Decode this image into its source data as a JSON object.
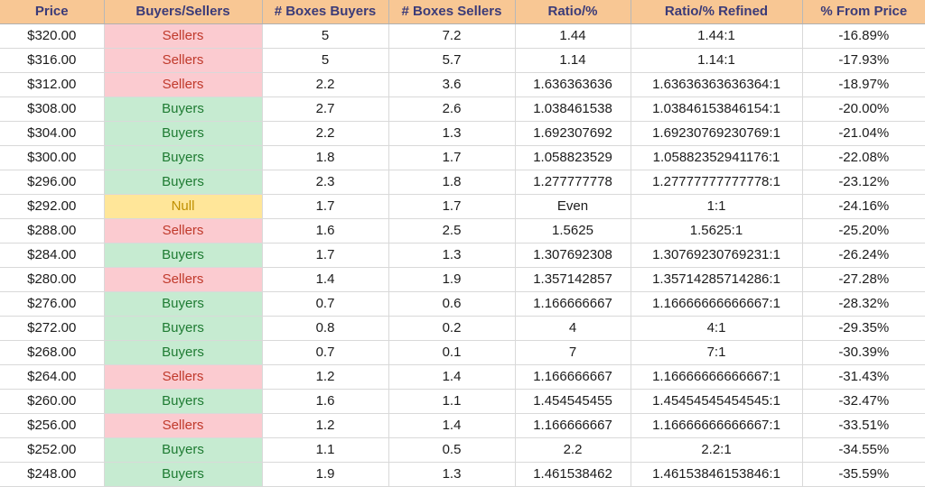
{
  "table": {
    "columns": [
      {
        "key": "price",
        "label": "Price"
      },
      {
        "key": "state",
        "label": "Buyers/Sellers"
      },
      {
        "key": "boxes_buy",
        "label": "# Boxes Buyers"
      },
      {
        "key": "boxes_sell",
        "label": "# Boxes Sellers"
      },
      {
        "key": "ratio",
        "label": "Ratio/%"
      },
      {
        "key": "ratio_ref",
        "label": "Ratio/% Refined"
      },
      {
        "key": "from_price",
        "label": "% From Price"
      }
    ],
    "colors": {
      "header_bg": "#F8C794",
      "header_text": "#3B3B78",
      "buyers_bg": "#C6EBD1",
      "buyers_text": "#1E7B32",
      "sellers_bg": "#FBCBD0",
      "sellers_text": "#C0392B",
      "null_bg": "#FFE699",
      "null_text": "#BF8F00",
      "grid": "#D9D9D9"
    },
    "rows": [
      {
        "price": "$320.00",
        "state": "Sellers",
        "boxes_buy": "5",
        "boxes_sell": "7.2",
        "ratio": "1.44",
        "ratio_ref": "1.44:1",
        "from_price": "-16.89%"
      },
      {
        "price": "$316.00",
        "state": "Sellers",
        "boxes_buy": "5",
        "boxes_sell": "5.7",
        "ratio": "1.14",
        "ratio_ref": "1.14:1",
        "from_price": "-17.93%"
      },
      {
        "price": "$312.00",
        "state": "Sellers",
        "boxes_buy": "2.2",
        "boxes_sell": "3.6",
        "ratio": "1.636363636",
        "ratio_ref": "1.63636363636364:1",
        "from_price": "-18.97%"
      },
      {
        "price": "$308.00",
        "state": "Buyers",
        "boxes_buy": "2.7",
        "boxes_sell": "2.6",
        "ratio": "1.038461538",
        "ratio_ref": "1.03846153846154:1",
        "from_price": "-20.00%"
      },
      {
        "price": "$304.00",
        "state": "Buyers",
        "boxes_buy": "2.2",
        "boxes_sell": "1.3",
        "ratio": "1.692307692",
        "ratio_ref": "1.69230769230769:1",
        "from_price": "-21.04%"
      },
      {
        "price": "$300.00",
        "state": "Buyers",
        "boxes_buy": "1.8",
        "boxes_sell": "1.7",
        "ratio": "1.058823529",
        "ratio_ref": "1.05882352941176:1",
        "from_price": "-22.08%"
      },
      {
        "price": "$296.00",
        "state": "Buyers",
        "boxes_buy": "2.3",
        "boxes_sell": "1.8",
        "ratio": "1.277777778",
        "ratio_ref": "1.27777777777778:1",
        "from_price": "-23.12%"
      },
      {
        "price": "$292.00",
        "state": "Null",
        "boxes_buy": "1.7",
        "boxes_sell": "1.7",
        "ratio": "Even",
        "ratio_ref": "1:1",
        "from_price": "-24.16%"
      },
      {
        "price": "$288.00",
        "state": "Sellers",
        "boxes_buy": "1.6",
        "boxes_sell": "2.5",
        "ratio": "1.5625",
        "ratio_ref": "1.5625:1",
        "from_price": "-25.20%"
      },
      {
        "price": "$284.00",
        "state": "Buyers",
        "boxes_buy": "1.7",
        "boxes_sell": "1.3",
        "ratio": "1.307692308",
        "ratio_ref": "1.30769230769231:1",
        "from_price": "-26.24%"
      },
      {
        "price": "$280.00",
        "state": "Sellers",
        "boxes_buy": "1.4",
        "boxes_sell": "1.9",
        "ratio": "1.357142857",
        "ratio_ref": "1.35714285714286:1",
        "from_price": "-27.28%"
      },
      {
        "price": "$276.00",
        "state": "Buyers",
        "boxes_buy": "0.7",
        "boxes_sell": "0.6",
        "ratio": "1.166666667",
        "ratio_ref": "1.16666666666667:1",
        "from_price": "-28.32%"
      },
      {
        "price": "$272.00",
        "state": "Buyers",
        "boxes_buy": "0.8",
        "boxes_sell": "0.2",
        "ratio": "4",
        "ratio_ref": "4:1",
        "from_price": "-29.35%"
      },
      {
        "price": "$268.00",
        "state": "Buyers",
        "boxes_buy": "0.7",
        "boxes_sell": "0.1",
        "ratio": "7",
        "ratio_ref": "7:1",
        "from_price": "-30.39%"
      },
      {
        "price": "$264.00",
        "state": "Sellers",
        "boxes_buy": "1.2",
        "boxes_sell": "1.4",
        "ratio": "1.166666667",
        "ratio_ref": "1.16666666666667:1",
        "from_price": "-31.43%"
      },
      {
        "price": "$260.00",
        "state": "Buyers",
        "boxes_buy": "1.6",
        "boxes_sell": "1.1",
        "ratio": "1.454545455",
        "ratio_ref": "1.45454545454545:1",
        "from_price": "-32.47%"
      },
      {
        "price": "$256.00",
        "state": "Sellers",
        "boxes_buy": "1.2",
        "boxes_sell": "1.4",
        "ratio": "1.166666667",
        "ratio_ref": "1.16666666666667:1",
        "from_price": "-33.51%"
      },
      {
        "price": "$252.00",
        "state": "Buyers",
        "boxes_buy": "1.1",
        "boxes_sell": "0.5",
        "ratio": "2.2",
        "ratio_ref": "2.2:1",
        "from_price": "-34.55%"
      },
      {
        "price": "$248.00",
        "state": "Buyers",
        "boxes_buy": "1.9",
        "boxes_sell": "1.3",
        "ratio": "1.461538462",
        "ratio_ref": "1.46153846153846:1",
        "from_price": "-35.59%"
      }
    ]
  }
}
